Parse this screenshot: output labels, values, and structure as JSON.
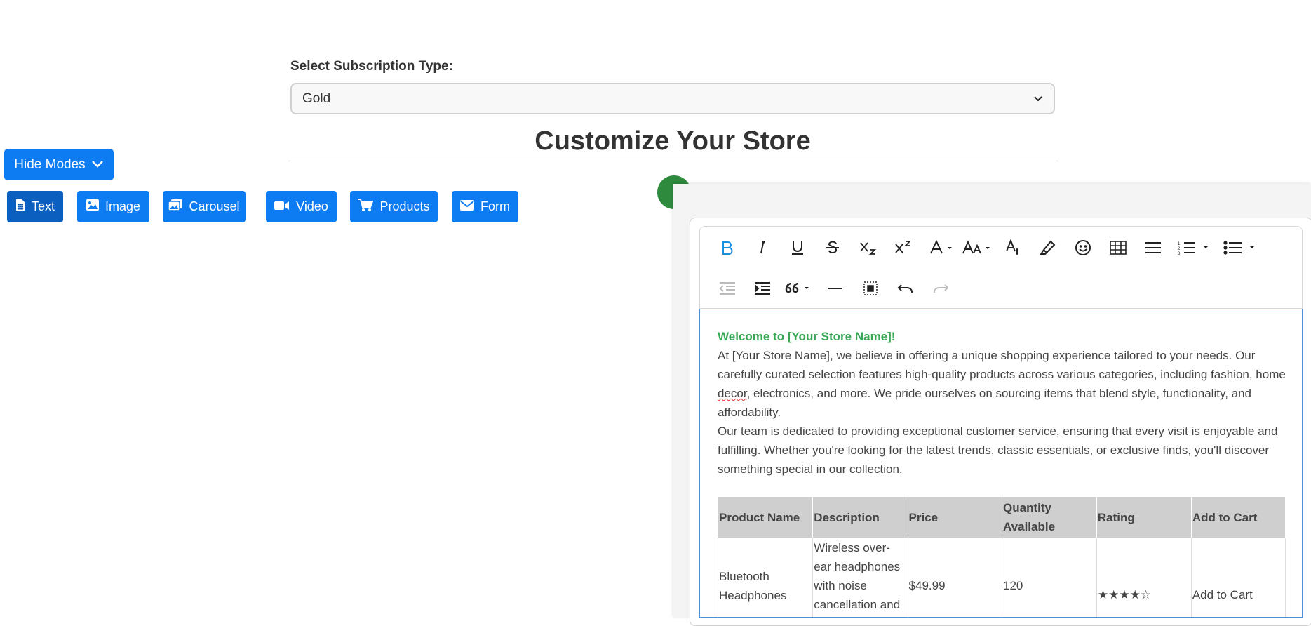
{
  "subscription": {
    "label": "Select Subscription Type:",
    "selected": "Gold"
  },
  "page_title": "Customize Your Store",
  "hide_modes_label": "Hide Modes",
  "modes": [
    {
      "label": "Text",
      "icon": "file-icon",
      "active": true
    },
    {
      "label": "Image",
      "icon": "image-icon",
      "active": false
    },
    {
      "label": "Carousel",
      "icon": "images-icon",
      "active": false
    },
    {
      "label": "Video",
      "icon": "video-icon",
      "active": false
    },
    {
      "label": "Products",
      "icon": "cart-icon",
      "active": false
    },
    {
      "label": "Form",
      "icon": "envelope-icon",
      "active": false
    }
  ],
  "toolbar": {
    "row1": [
      "bold-icon",
      "italic-icon",
      "underline-icon",
      "strikethrough-icon",
      "subscript-icon",
      "superscript-icon",
      "font-color-icon",
      "font-size-icon",
      "text-color-icon",
      "highlight-icon",
      "emoji-icon",
      "table-icon",
      "align-icon",
      "ordered-list-icon",
      "unordered-list-icon"
    ],
    "row2": [
      "outdent-icon",
      "indent-icon",
      "blockquote-icon",
      "horizontal-rule-icon",
      "select-all-icon",
      "undo-icon",
      "redo-icon"
    ]
  },
  "content": {
    "heading": "Welcome to [Your Store Name]!",
    "para1_a": "At [Your Store Name], we believe in offering a unique shopping experience tailored to your needs. Our carefully curated selection features high-quality products across various categories, including fashion, home ",
    "para1_b": "decor",
    "para1_c": ", electronics, and more. We pride ourselves on sourcing items that blend style, functionality, and affordability.",
    "para2": "Our team is dedicated to providing exceptional customer service, ensuring that every visit is enjoyable and fulfilling. Whether you're looking for the latest trends, classic essentials, or exclusive finds, you'll discover something special in our collection."
  },
  "table": {
    "headers": [
      "Product Name",
      "Description",
      "Price",
      "Quantity Available",
      "Rating",
      "Add to Cart"
    ],
    "rows": [
      [
        "Bluetooth Headphones",
        "Wireless over-ear headphones with noise cancellation and long battery life",
        "$49.99",
        "120",
        "★★★★☆",
        "Add to Cart"
      ]
    ]
  },
  "colors": {
    "primary": "#0d7cf2",
    "primary_active": "#0a5fbf",
    "welcome_green": "#3aa757",
    "bold_active": "#1a8fe0"
  }
}
